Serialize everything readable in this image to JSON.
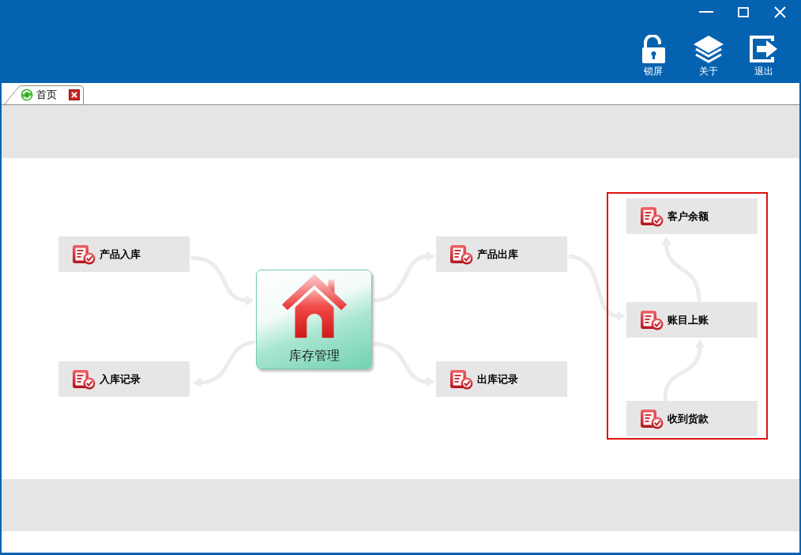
{
  "toolbar": [
    {
      "kind": "lock",
      "label": "锁屏"
    },
    {
      "kind": "about",
      "label": "关于"
    },
    {
      "kind": "exit",
      "label": "退出"
    }
  ],
  "tabs": [
    {
      "label": "首页",
      "selected": true,
      "closable": true
    }
  ],
  "diagram": {
    "hub": {
      "label": "库存管理"
    },
    "inbound": [
      {
        "label": "产品入库"
      },
      {
        "label": "入库记录"
      }
    ],
    "outbound": [
      {
        "label": "产品出库"
      },
      {
        "label": "出库记录"
      }
    ],
    "finance": {
      "outlined": true,
      "nodes": [
        {
          "label": "客户余额"
        },
        {
          "label": "账目上账"
        },
        {
          "label": "收到货款"
        }
      ]
    }
  }
}
